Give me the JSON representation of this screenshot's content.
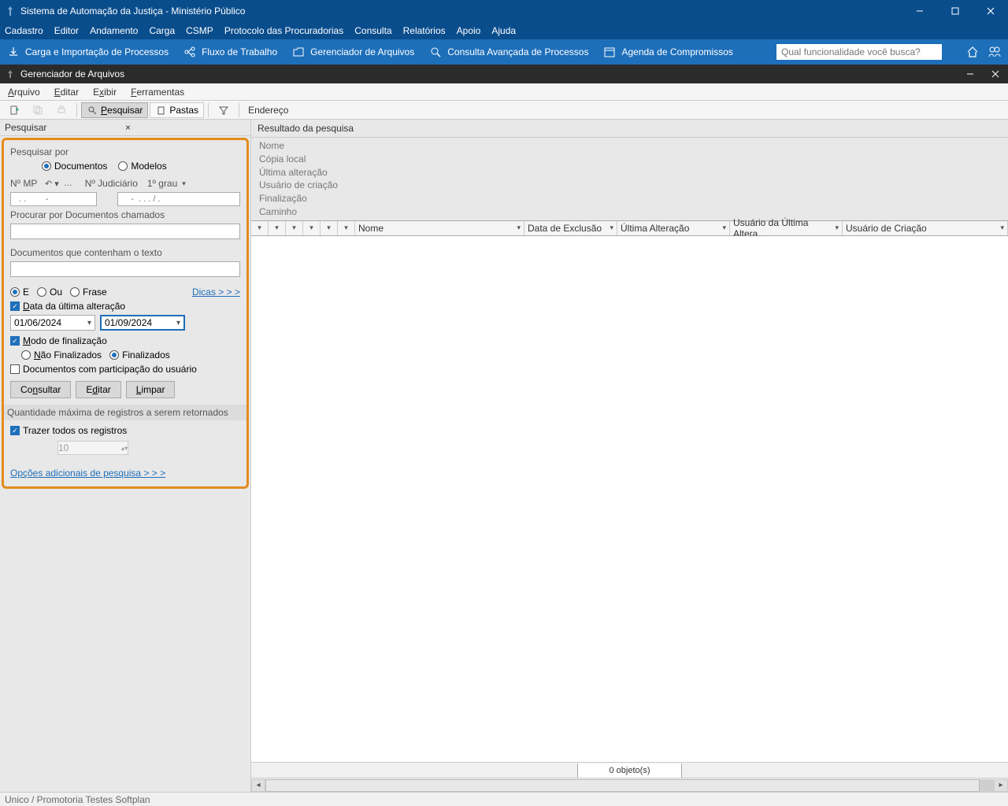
{
  "titlebar": {
    "title": "Sistema de Automação da Justiça - Ministério Público"
  },
  "menu": [
    "Cadastro",
    "Editor",
    "Andamento",
    "Carga",
    "CSMP",
    "Protocolo das Procuradorias",
    "Consulta",
    "Relatórios",
    "Apoio",
    "Ajuda"
  ],
  "toolbar": {
    "items": [
      {
        "label": "Carga e Importação de Processos"
      },
      {
        "label": "Fluxo de Trabalho"
      },
      {
        "label": "Gerenciador de Arquivos"
      },
      {
        "label": "Consulta Avançada de Processos"
      },
      {
        "label": "Agenda de Compromissos"
      }
    ],
    "search_placeholder": "Qual funcionalidade você busca?"
  },
  "subwin": {
    "title": "Gerenciador de Arquivos"
  },
  "submenu": [
    "Arquivo",
    "Editar",
    "Exibir",
    "Ferramentas"
  ],
  "subtoolbar": {
    "pesquisar_label": "Pesquisar",
    "pastas_label": "Pastas",
    "endereco_label": "Endereço"
  },
  "search": {
    "panel_title": "Pesquisar",
    "pesquisar_por": "Pesquisar por",
    "documentos": "Documentos",
    "modelos": "Modelos",
    "n_mp": "Nº MP",
    "n_judiciario": "Nº Judiciário",
    "grau": "1º grau",
    "mp_placeholder": "  . .        -",
    "jud_placeholder": "    -  . . . / .",
    "procurar_label": "Procurar por Documentos chamados",
    "contenham_label": "Documentos que contenham o texto",
    "e": "E",
    "ou": "Ou",
    "frase": "Frase",
    "dicas": "Dicas > > >",
    "data_ultima": "Data da última alteração",
    "date_from": "01/06/2024",
    "date_to": "01/09/2024",
    "modo_final": "Modo de finalização",
    "nao_final": "Não Finalizados",
    "final": "Finalizados",
    "participacao": "Documentos com participação do usuário",
    "consultar": "Consultar",
    "editar": "Editar",
    "limpar": "Limpar",
    "quantidade_label": "Quantidade máxima de registros a serem retornados",
    "trazer_todos": "Trazer todos os registros",
    "max_value": "10",
    "opcoes": "Opções adicionais de pesquisa > > >"
  },
  "results": {
    "title": "Resultado da pesquisa",
    "details": [
      "Nome",
      "Cópia local",
      "Última alteração",
      "Usuário de criação",
      "Finalização",
      "Caminho"
    ],
    "columns": [
      "Nome",
      "Data de Exclusão",
      "Última Alteração",
      "Usuário da Última Altera...",
      "Usuário de Criação"
    ],
    "count": "0 objeto(s)"
  },
  "statusbar": "Unico / Promotoria Testes Softplan"
}
